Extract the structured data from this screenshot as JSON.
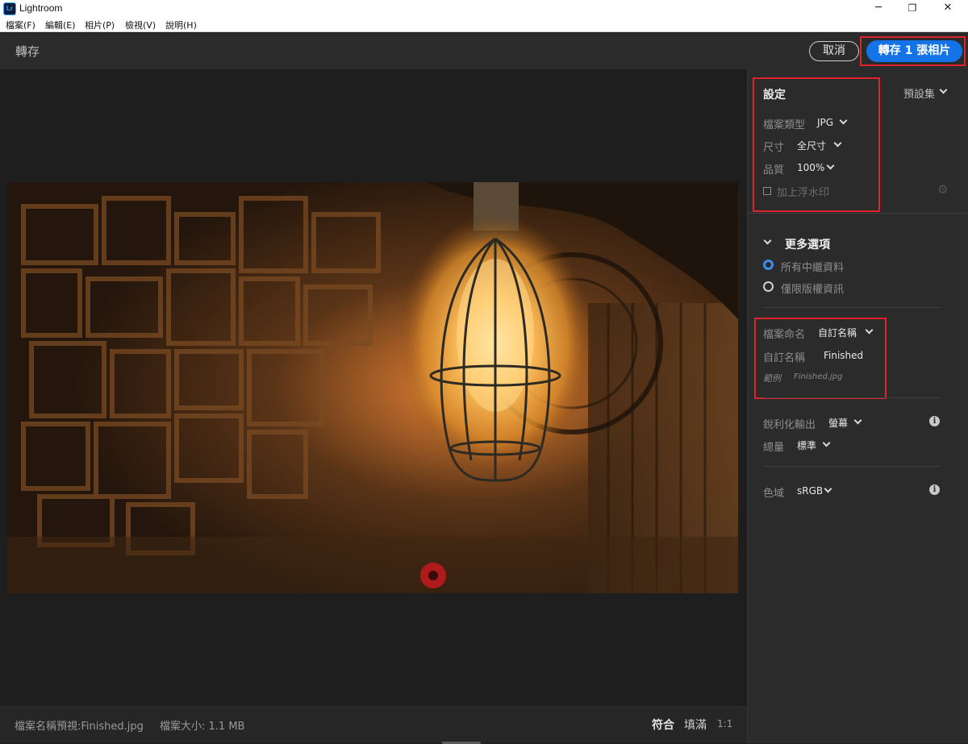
{
  "window": {
    "logo_text": "Lr",
    "title": "Lightroom",
    "minimize": "─",
    "restore": "❐",
    "close": "✕"
  },
  "menu": [
    "檔案(F)",
    "編輯(E)",
    "相片(P)",
    "檢視(V)",
    "說明(H)"
  ],
  "header": {
    "title": "轉存",
    "cancel_label": "取消",
    "export_label": "轉存 1 張相片",
    "accent_color": "#1473e6"
  },
  "settings": {
    "heading": "設定",
    "presets_label": "預設集",
    "file_type_label": "檔案類型",
    "file_type_value": "JPG",
    "size_label": "尺寸",
    "size_value": "全尺寸",
    "quality_label": "品質",
    "quality_value": "100%",
    "watermark_label": "加上浮水印",
    "watermark_checked": false
  },
  "more_options": {
    "heading": "更多選項",
    "metadata_all": "所有中繼資料",
    "metadata_copyright": "僅限版權資訊",
    "selected": "metadata_all",
    "file_naming_label": "檔案命名",
    "file_naming_value": "自訂名稱",
    "custom_name_label": "自訂名稱",
    "custom_name_value": "Finished",
    "example_label": "範例",
    "example_value": "Finished.jpg",
    "sharpen_label": "銳利化輸出",
    "sharpen_value": "螢幕",
    "amount_label": "總量",
    "amount_value": "標準",
    "color_space_label": "色域",
    "color_space_value": "sRGB"
  },
  "footer": {
    "filename_preview": "檔案名稱預視:Finished.jpg",
    "file_size": "檔案大小: 1.1 MB",
    "fit_label": "符合",
    "fill_label": "填滿",
    "one_to_one_label": "1:1"
  },
  "highlight_color": "#e0222c"
}
